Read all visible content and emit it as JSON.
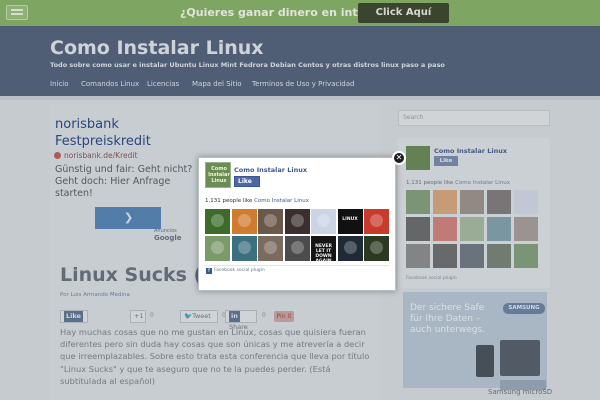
{
  "promo": {
    "text": "¿Quieres ganar dinero en internet?",
    "button": "Click Aquí AHORA",
    "colors": {
      "bar": "#8ab36c",
      "button": "#3f4a33"
    }
  },
  "header": {
    "title": "Como Instalar Linux",
    "description": "Todo sobre como usar e instalar Ubuntu Linux Mint Fedrora Debian Centos y otras distros linux paso a paso"
  },
  "nav": {
    "items": [
      "Inicio",
      "Comandos Linux",
      "Licencias",
      "Mapa del Sitio",
      "Terminos de Uso y Privacidad"
    ]
  },
  "ad": {
    "title": "norisbank Festpreiskredit",
    "advertiser": "norisbank.de/Kredit",
    "copy": "Günstig und fair: Geht nicht? Geht doch: Hier Anfrage starten!",
    "button_icon": "chevron-right-icon",
    "ads_by": "Anuncios",
    "ads_brand": "Google"
  },
  "post": {
    "title": "Linux Sucks (Li",
    "meta_prefix": "Por",
    "author": "Luis Armando Medina",
    "share": {
      "like": "Like",
      "gplus": "+1",
      "gplus_count": "0",
      "tweet": "Tweet",
      "tweet_count": "0",
      "linkedin": "Share",
      "linkedin_count": "0",
      "pin": "Pin it"
    },
    "body": "Hay muchas cosas que no me gustan en Linux, cosas que quisiera fueran diferentes pero sin duda hay cosas que son únicas y me atrevería a decir que irreemplazables. Sobre esto trata esta conferencia que lleva por título \"Linux Sucks\" y que te aseguro que no te la puedes perder. (Está subtitulada al español)"
  },
  "sidebar": {
    "search_placeholder": "Search",
    "fb_page": "Como Instalar Linux",
    "fb_like": "Like",
    "count_prefix": "1,131 people like",
    "count_link": "Como Instalar Linux",
    "plugin": "Facebook social plugin",
    "ad_text": "Der sichere Safe für Ihre Daten – auch unterwegs.",
    "ad_brand": "SAMSUNG",
    "ad_caption": "Samsung microSD"
  },
  "modal": {
    "logo_text": "Como Instalar Linux",
    "page_name": "Como Instalar Linux",
    "like_label": "Like",
    "count_prefix": "1,131 people like",
    "count_link": "Como Instalar Linux",
    "close_icon": "close-icon",
    "faces": [
      {
        "color": "#3d6b2a",
        "label": ""
      },
      {
        "color": "#d07c30",
        "label": ""
      },
      {
        "color": "#6a5848",
        "label": ""
      },
      {
        "color": "#3a2e2e",
        "label": ""
      },
      {
        "color": "#c9d4e4",
        "label": ""
      },
      {
        "color": "#111111",
        "label": "LINUX"
      },
      {
        "color": "#c83a2c",
        "label": ""
      },
      {
        "color": "#7b9a6a",
        "label": ""
      },
      {
        "color": "#3c6f80",
        "label": ""
      },
      {
        "color": "#7b6a5e",
        "label": ""
      },
      {
        "color": "#4c4c4c",
        "label": ""
      },
      {
        "color": "#151515",
        "label": "NEVER LET IT DOWN AGAIN"
      },
      {
        "color": "#1e2a36",
        "label": ""
      },
      {
        "color": "#2c3a22",
        "label": ""
      }
    ],
    "plugin": "Facebook social plugin"
  }
}
